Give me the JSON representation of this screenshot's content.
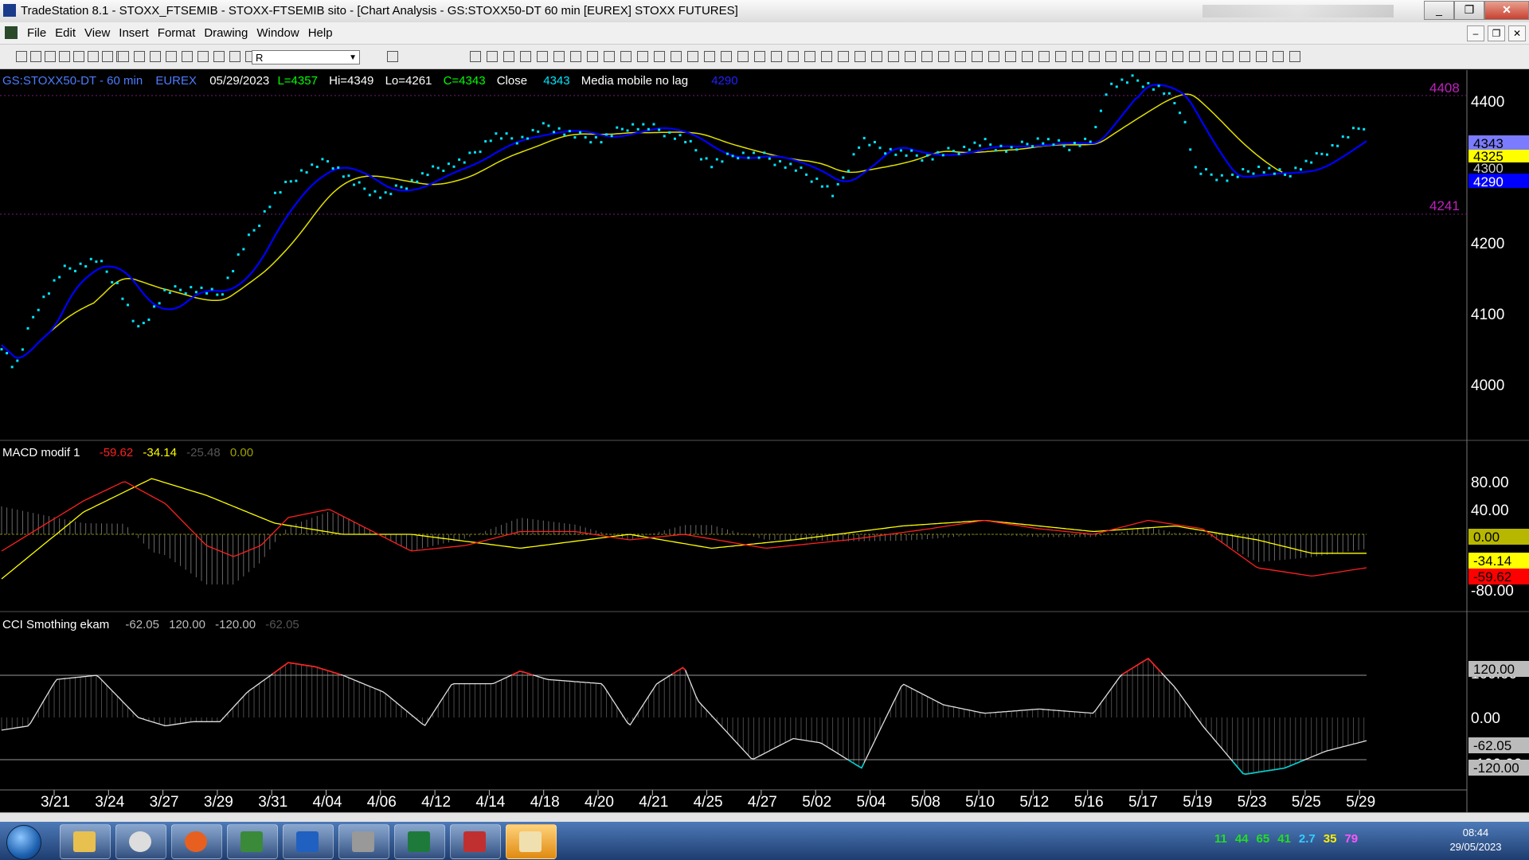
{
  "window": {
    "title": "TradeStation 8.1 - STOXX_FTSEMIB - STOXX-FTSEMIB sito - [Chart Analysis - GS:STOXX50-DT  60 min  [EUREX] STOXX FUTURES]",
    "buttons": [
      "_",
      "❐",
      "✕"
    ]
  },
  "menu": {
    "items": [
      "File",
      "Edit",
      "View",
      "Insert",
      "Format",
      "Drawing",
      "Window",
      "Help"
    ],
    "mdi_buttons": [
      "–",
      "❐",
      "✕"
    ]
  },
  "toolbar": {
    "symbol_value": "R"
  },
  "price_panel": {
    "symbol": "GS:STOXX50-DT - 60 min",
    "exchange": "EUREX",
    "date": "05/29/2023",
    "last": "L=4357",
    "high": "Hi=4349",
    "low": "Lo=4261",
    "close": "C=4343",
    "close_label": "Close",
    "close_value": "4343",
    "ma_label": "Media mobile no lag",
    "ma_value": "4290",
    "level_top": "4408",
    "level_bottom": "4241",
    "axis_labels": [
      "4400",
      "4300",
      "4200",
      "4100",
      "4000"
    ],
    "badges": [
      {
        "text": "4343",
        "bg": "#7b7bff",
        "fg": "#000000"
      },
      {
        "text": "4325",
        "bg": "#ffff00",
        "fg": "#000000"
      },
      {
        "text": "4300",
        "bg": "#000000",
        "fg": "#cfcfcf"
      },
      {
        "text": "4290",
        "bg": "#0000ff",
        "fg": "#ffffff"
      }
    ]
  },
  "macd_panel": {
    "name": "MACD modif 1",
    "v1": "-59.62",
    "v2": "-34.14",
    "v3": "-25.48",
    "v4": "0.00",
    "axis_labels": [
      "80.00",
      "40.00",
      "-80.00"
    ],
    "badges": [
      {
        "text": "0.00",
        "bg": "#b7b700",
        "fg": "#000000"
      },
      {
        "text": "-34.14",
        "bg": "#ffff00",
        "fg": "#000000"
      },
      {
        "text": "-59.62",
        "bg": "#ff0000",
        "fg": "#000000"
      }
    ]
  },
  "cci_panel": {
    "name": "CCI Smothing ekam",
    "v1": "-62.05",
    "v2": "120.00",
    "v3": "-120.00",
    "v4": "-62.05",
    "axis_labels": [
      "100.00",
      "0.00",
      "-100.00"
    ],
    "badges": [
      {
        "text": "120.00",
        "bg": "#bbbbbb",
        "fg": "#000000"
      },
      {
        "text": "-62.05",
        "bg": "#bbbbbb",
        "fg": "#000000"
      },
      {
        "text": "-120.00",
        "bg": "#bbbbbb",
        "fg": "#000000"
      }
    ]
  },
  "x_axis_labels": [
    "3/21",
    "3/24",
    "3/27",
    "3/29",
    "3/31",
    "4/04",
    "4/06",
    "4/12",
    "4/14",
    "4/18",
    "4/20",
    "4/21",
    "4/25",
    "4/27",
    "5/02",
    "5/04",
    "5/08",
    "5/10",
    "5/12",
    "5/16",
    "5/17",
    "5/19",
    "5/23",
    "5/25",
    "5/29"
  ],
  "taskbar": {
    "tray_numbers": [
      {
        "text": "11",
        "color": "#22dd22"
      },
      {
        "text": "44",
        "color": "#22dd22"
      },
      {
        "text": "65",
        "color": "#22dd22"
      },
      {
        "text": "41",
        "color": "#22dd22"
      },
      {
        "text": "2.7",
        "color": "#33ccff"
      },
      {
        "text": "35",
        "color": "#ffee00"
      },
      {
        "text": "79",
        "color": "#ff55ff"
      }
    ],
    "time": "08:44",
    "date": "29/05/2023"
  },
  "colors": {
    "price_dots": "#00e5ff",
    "ma_blue": "#0000ff",
    "ma_yellow": "#e0e000",
    "macd_red": "#ff2020",
    "macd_yellow": "#ffff00",
    "cci_line": "#e0e0e0",
    "level_magenta": "#c020c0"
  },
  "icons": [
    "tradestation-icon",
    "windows-start-icon",
    "explorer-icon",
    "chrome-icon",
    "firefox-icon",
    "tradestation-task-icon",
    "network-icon",
    "excel-icon",
    "chart-task-icon",
    "outlook-icon"
  ]
}
